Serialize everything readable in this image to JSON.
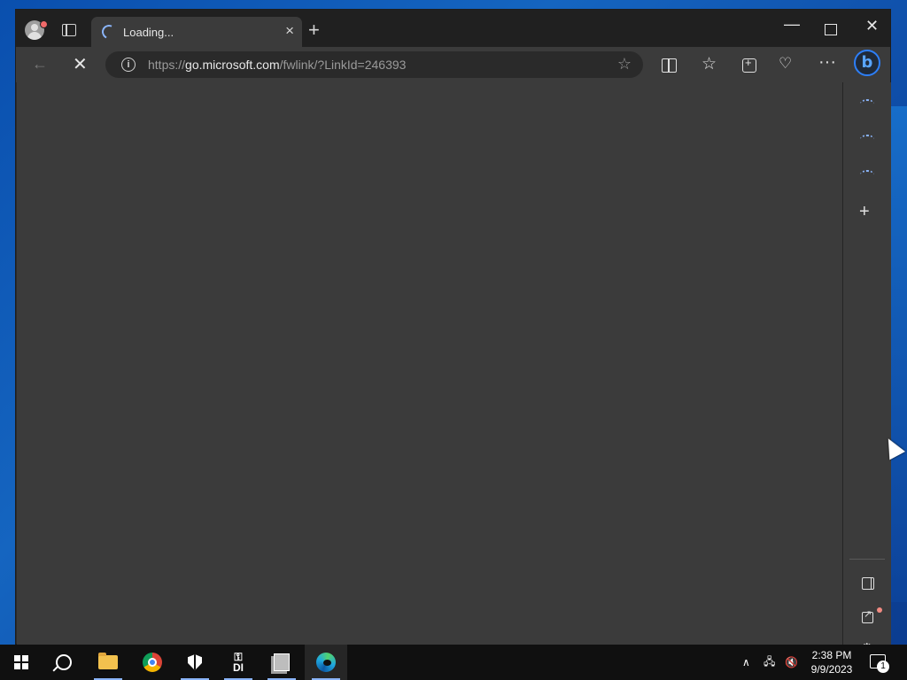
{
  "browser": {
    "tab": {
      "title": "Loading..."
    },
    "address": {
      "url_prefix": "https://",
      "url_host": "go.microsoft.com",
      "url_path": "/fwlink/?LinkId=246393"
    }
  },
  "icons": {
    "profile": "profile-avatar",
    "tab_actions": "tab-actions-icon",
    "tab_close": "×",
    "new_tab": "+",
    "minimize": "—",
    "maximize": "maximize-icon",
    "close": "✕",
    "back": "←",
    "stop": "✕",
    "info": "i",
    "favorite": "☆",
    "favorites": "☆",
    "more": "···",
    "bing": "b",
    "sidebar_add": "+",
    "settings": "⚙"
  },
  "taskbar": {
    "clock_time": "2:38 PM",
    "clock_date": "9/9/2023",
    "keyapp_label": "DI",
    "notification_count": "1"
  },
  "colors": {
    "accent": "#8ab4f8",
    "window_bg": "#3b3b3b",
    "titlebar_bg": "#202020",
    "taskbar_bg": "#101010"
  }
}
